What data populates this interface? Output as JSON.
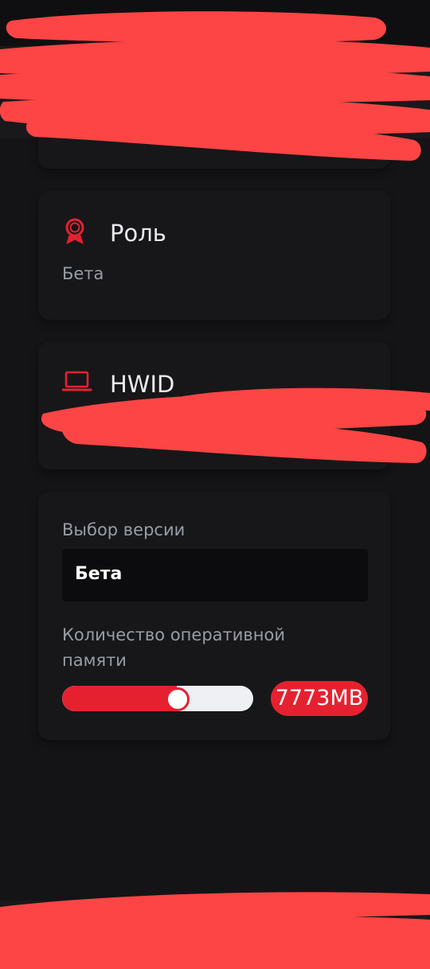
{
  "role_card": {
    "title": "Роль",
    "value": "Бета",
    "icon": "award-icon"
  },
  "hwid_card": {
    "title": "HWID",
    "icon": "laptop-icon"
  },
  "settings": {
    "version_label": "Выбор версии",
    "version_selected": "Бета",
    "ram_label": "Количество оперативной памяти",
    "ram_value": "7773MB",
    "ram_slider_fraction": 0.6
  },
  "colors": {
    "background": "#141416",
    "card": "#171719",
    "accent": "#e52130",
    "redaction": "#fc4544"
  }
}
